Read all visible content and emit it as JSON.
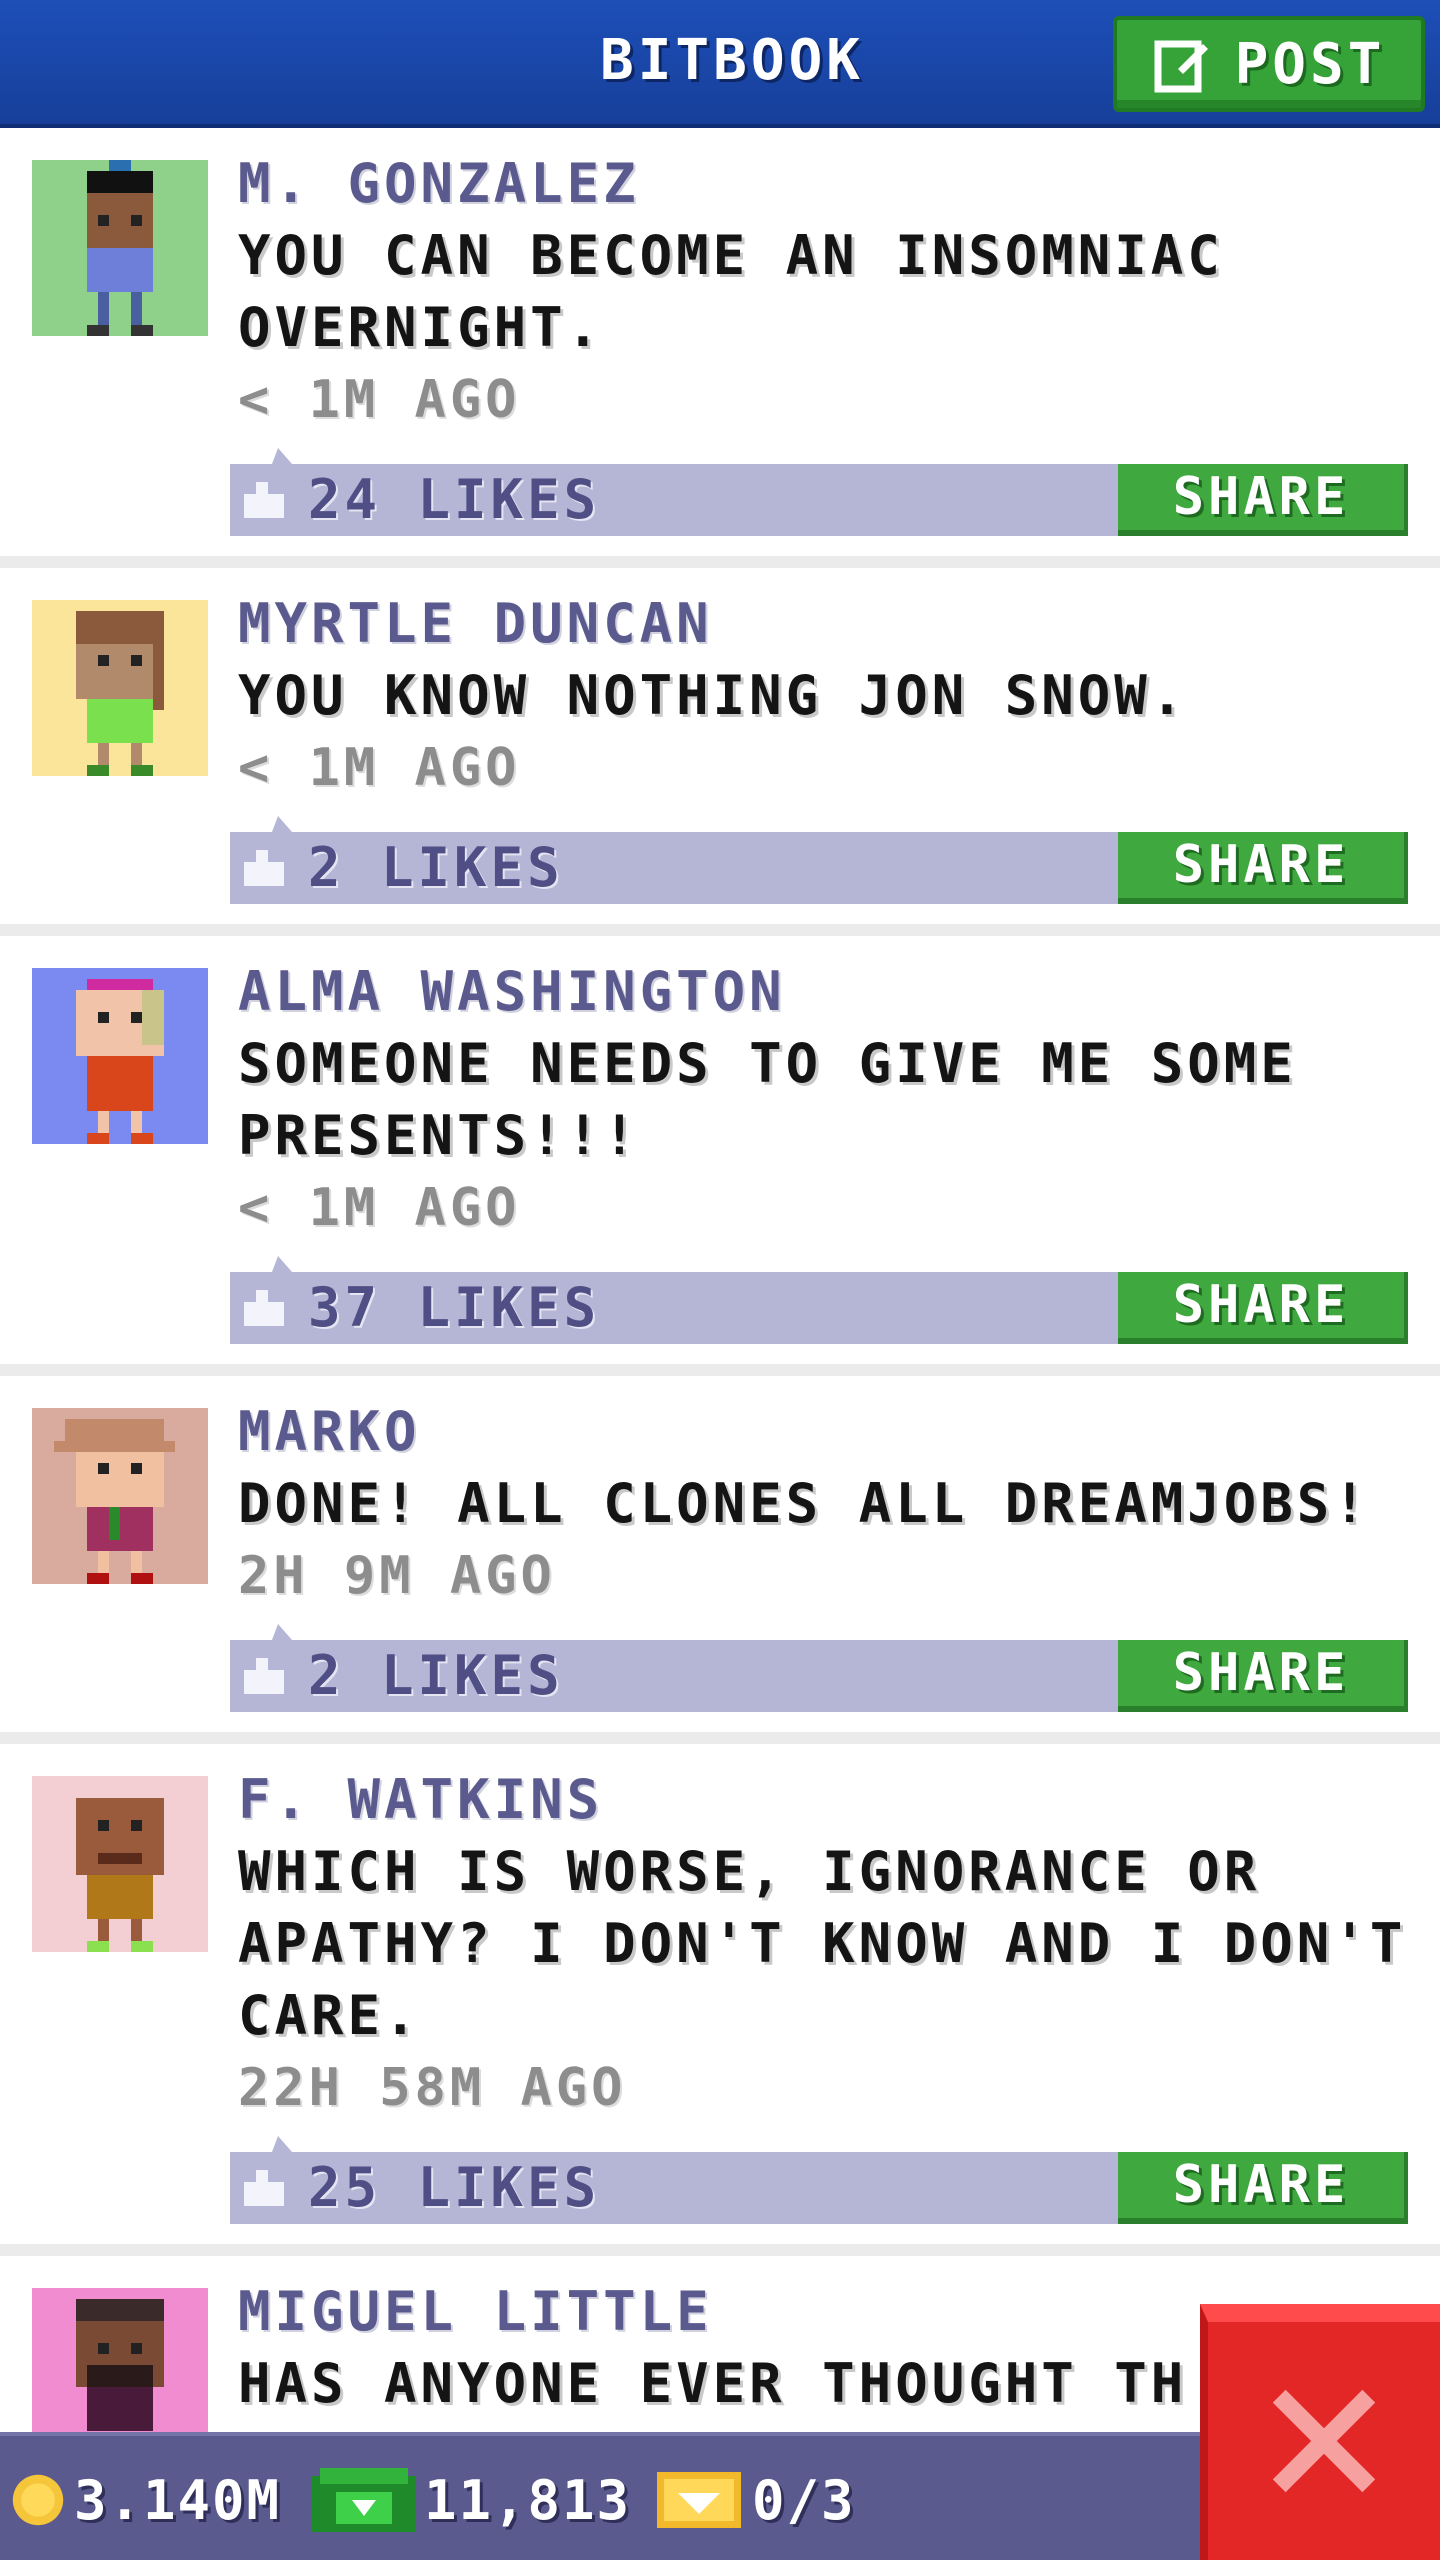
{
  "header": {
    "title": "BITBOOK",
    "post_label": "POST"
  },
  "posts": [
    {
      "author": "M. GONZALEZ",
      "message": "YOU CAN BECOME AN INSOMNIAC OVERNIGHT.",
      "time": "< 1M AGO",
      "likes": "24 LIKES",
      "share": "SHARE",
      "avatar_bg": "#8fd18a"
    },
    {
      "author": "MYRTLE DUNCAN",
      "message": "YOU KNOW NOTHING JON SNOW.",
      "time": "< 1M AGO",
      "likes": "2 LIKES",
      "share": "SHARE",
      "avatar_bg": "#fbe59a"
    },
    {
      "author": "ALMA WASHINGTON",
      "message": "SOMEONE NEEDS TO GIVE ME SOME PRESENTS!!!",
      "time": "< 1M AGO",
      "likes": "37 LIKES",
      "share": "SHARE",
      "avatar_bg": "#7b8af0"
    },
    {
      "author": "MARKO",
      "message": "DONE! ALL CLONES ALL DREAMJOBS!",
      "time": "2H 9M AGO",
      "likes": "2 LIKES",
      "share": "SHARE",
      "avatar_bg": "#d9aa9e"
    },
    {
      "author": "F. WATKINS",
      "message": "WHICH IS WORSE, IGNORANCE OR APATHY? I DON'T KNOW AND I DON'T CARE.",
      "time": "22H 58M AGO",
      "likes": "25 LIKES",
      "share": "SHARE",
      "avatar_bg": "#f3cfd3"
    },
    {
      "author": "MIGUEL LITTLE",
      "message": "HAS ANYONE EVER THOUGHT TH",
      "avatar_bg": "#f08ccf"
    }
  ],
  "bottom_bar": {
    "coins": "3.140M",
    "cash": "11,813",
    "tickets": "0/3"
  },
  "colors": {
    "header": "#1d4fb8",
    "post_button": "#36a339",
    "likes_bar": "#b5b5d6",
    "share_button": "#3fa83f",
    "bottom_bar": "#5a5a8e",
    "close_button": "#e32626"
  }
}
